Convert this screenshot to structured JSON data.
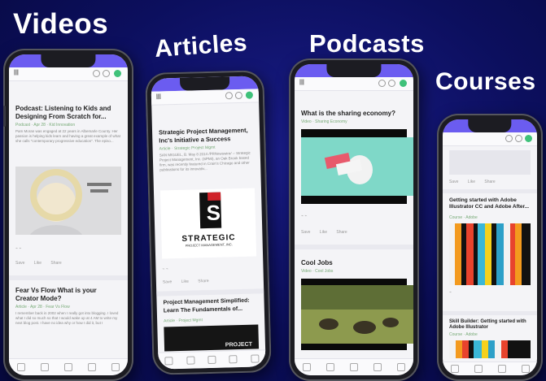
{
  "headlines": {
    "videos": "Videos",
    "articles": "Articles",
    "podcasts": "Podcasts",
    "courses": "Courses"
  },
  "colors": {
    "background": "#0c0f5e",
    "accent": "#6b5cf0",
    "green": "#3fc17a"
  },
  "phone_videos": {
    "card1_title": "Podcast: Listening to Kids and Designing From Scratch for...",
    "card1_meta": "Podcast · Apr 28 · Kid Innovation",
    "card1_text": "Pam Moran was engaged at 22 years in Albemarle County. Her passion is helping kids learn and having a great example of what she calls \"contemporary progressive education\". The episo...",
    "card1_actions": [
      "Save",
      "Like",
      "Share"
    ],
    "card2_title": "Fear Vs Flow What is your Creator Mode?",
    "card2_meta": "Article · Apr 28 · Fear Vs Flow",
    "card2_text": "I remember back in 2002 when I really got into blogging. I loved what I did so much so that I would wake up at 4 AM to write my next blog post. I have no idea why or how I did it, but I"
  },
  "phone_articles": {
    "card1_title": "Strategic Project Management, Inc's Initiative a Success",
    "card1_meta": "Article · Strategic Project Mgmt",
    "card1_text": "SAN MIGUEL, B. May 8 2014 /PRNewswire/ -- Strategic Project Management, Inc. (SPMI), an Oak Brook based firm, was recently featured in Crain's Chicago and other publications for its innovativ...",
    "logo_word": "STRATEGIC",
    "logo_sub": "PROJECT MANAGEMENT, INC.",
    "card1_actions": [
      "Save",
      "Like",
      "Share"
    ],
    "card2_title": "Project Management Simplified: Learn The Fundamentals of...",
    "card2_meta": "Article · Project Mgmt",
    "card2_banner": "PROJECT"
  },
  "phone_podcasts": {
    "card1_title": "What is the sharing economy?",
    "card1_meta": "Video · Sharing Economy",
    "card1_actions": [
      "Save",
      "Like",
      "Share"
    ],
    "card2_title": "Cool Jobs",
    "card2_meta": "Video · Cool Jobs"
  },
  "phone_courses": {
    "card1_title": "Getting started with Adobe Illustrator CC and Adobe After...",
    "card1_meta": "Course · Adobe",
    "card1_actions": [
      "Save",
      "Like",
      "Share"
    ],
    "card2_title": "Skill Builder: Getting started with Adobe Illustrator",
    "card2_meta": "Course · Adobe"
  }
}
